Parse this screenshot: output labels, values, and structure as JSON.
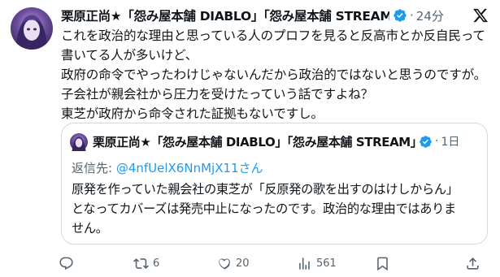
{
  "tweet": {
    "display_name": "栗原正尚★「怨み屋本舗 DIABLO」「怨み屋本舗 STREAM」「…",
    "time": "24分",
    "body_lines": [
      "これを政治的な理由と思っている人のプロフを見ると反高市とか反自民って",
      "書いてる人が多いけど、",
      "政府の命令でやったわけじゃないんだから政治的ではないと思うのですが。",
      "子会社が親会社から圧力を受けたっていう話ですよね？",
      "東芝が政府から命令された証拠もないですし。"
    ]
  },
  "quote": {
    "display_name": "栗原正尚★「怨み屋本舗 DIABLO」「怨み屋本舗 STREAM」…",
    "time": "1日",
    "reply_prefix": "返信先: ",
    "reply_handle": "@4nfUelX6NnMjX11さん",
    "body_lines": [
      "原発を作っていた親会社の東芝が「反原発の歌を出すのはけしからん」",
      "となってカバーズは発売中止になったのです。政治的な理由ではありま",
      "せん。"
    ]
  },
  "actions": {
    "reposts": "6",
    "likes": "20",
    "views": "561"
  },
  "colors": {
    "text": "#0f1419",
    "muted": "#536471",
    "accent": "#1d9bf0",
    "border": "#cfd9de"
  },
  "icons": [
    "avatar",
    "verified-badge-icon",
    "x-logo-icon",
    "reply-icon",
    "repost-icon",
    "like-icon",
    "views-icon",
    "bookmark-icon",
    "share-icon"
  ]
}
